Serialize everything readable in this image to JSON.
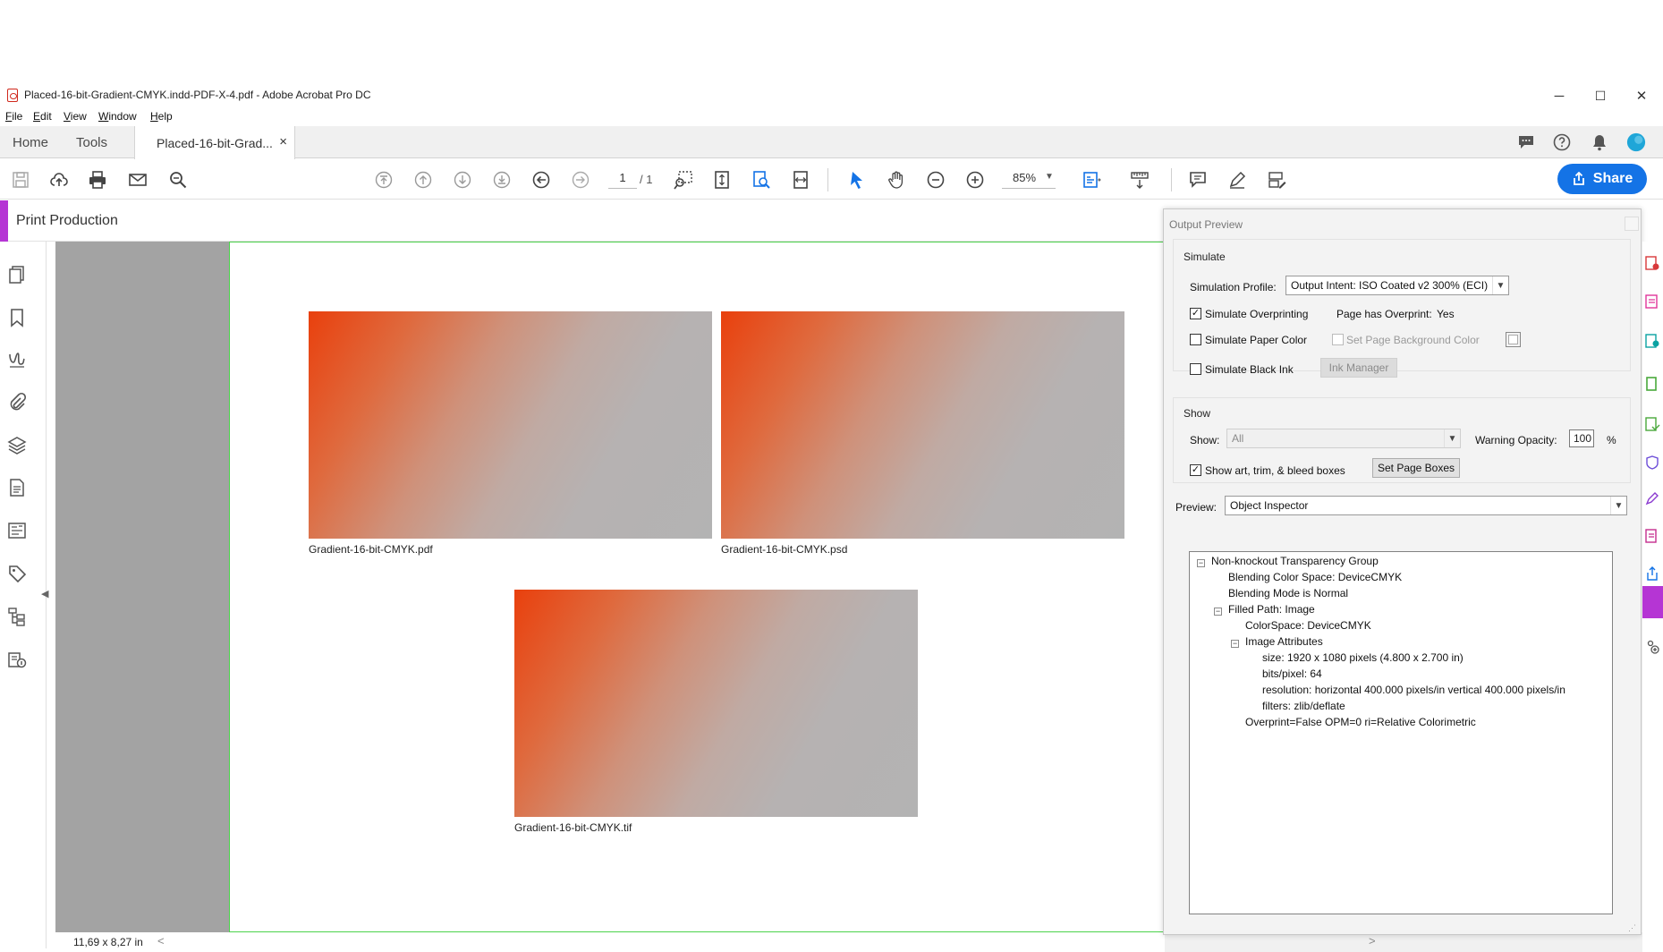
{
  "window": {
    "title": "Placed-16-bit-Gradient-CMYK.indd-PDF-X-4.pdf - Adobe Acrobat Pro DC",
    "minimize": "─",
    "maximize": "☐",
    "close": "✕"
  },
  "menu": [
    "File",
    "Edit",
    "View",
    "Window",
    "Help"
  ],
  "tabs": {
    "home": "Home",
    "tools": "Tools",
    "doc": "Placed-16-bit-Grad...",
    "doc_close": "×"
  },
  "toolbar": {
    "page_current": "1",
    "page_total": "/ 1",
    "zoom": "85%",
    "share": "Share"
  },
  "panel_title": "Print Production",
  "document": {
    "images": [
      {
        "caption": "Gradient-16-bit-CMYK.pdf"
      },
      {
        "caption": "Gradient-16-bit-CMYK.psd"
      },
      {
        "caption": "Gradient-16-bit-CMYK.tif"
      }
    ],
    "page_size": "11,69 x 8,27 in"
  },
  "output_preview": {
    "title": "Output Preview",
    "simulate": {
      "group_label": "Simulate",
      "profile_label": "Simulation Profile:",
      "profile_value": "Output Intent: ISO Coated v2 300% (ECI)",
      "simulate_overprinting": {
        "label": "Simulate Overprinting",
        "checked": true
      },
      "page_has_overprint_label": "Page has Overprint:",
      "page_has_overprint_value": "Yes",
      "simulate_paper_color": {
        "label": "Simulate Paper Color",
        "checked": false
      },
      "set_page_background_color": {
        "label": "Set Page Background Color",
        "checked": false
      },
      "simulate_black_ink": {
        "label": "Simulate Black Ink",
        "checked": false
      },
      "ink_manager": "Ink Manager"
    },
    "show": {
      "group_label": "Show",
      "show_label": "Show:",
      "show_value": "All",
      "warning_opacity_label": "Warning Opacity:",
      "warning_opacity_value": "100",
      "percent": "%",
      "show_boxes": {
        "label": "Show art, trim, & bleed boxes",
        "checked": true
      },
      "set_page_boxes": "Set Page Boxes"
    },
    "preview_label": "Preview:",
    "preview_value": "Object Inspector",
    "tree": [
      {
        "text": "Non-knockout Transparency Group",
        "toggle": "⊟"
      },
      {
        "text": "Blending Color Space: DeviceCMYK"
      },
      {
        "text": "Blending Mode is Normal"
      },
      {
        "text": "Filled Path: Image",
        "toggle": "⊟"
      },
      {
        "text": "ColorSpace: DeviceCMYK"
      },
      {
        "text": "Image Attributes",
        "toggle": "⊟"
      },
      {
        "text": "size: 1920 x 1080 pixels (4.800 x 2.700 in)"
      },
      {
        "text": "bits/pixel: 64"
      },
      {
        "text": "resolution: horizontal 400.000 pixels/in vertical 400.000 pixels/in"
      },
      {
        "text": "filters: zlib/deflate"
      },
      {
        "text": "Overprint=False OPM=0 ri=Relative Colorimetric"
      }
    ]
  },
  "colors": {
    "accent_blue": "#1473e6",
    "panel_accent": "#b535d4",
    "page_border": "#4bd34b",
    "gradient_start": "#e9400d",
    "gradient_end": "#b3b3b3"
  }
}
